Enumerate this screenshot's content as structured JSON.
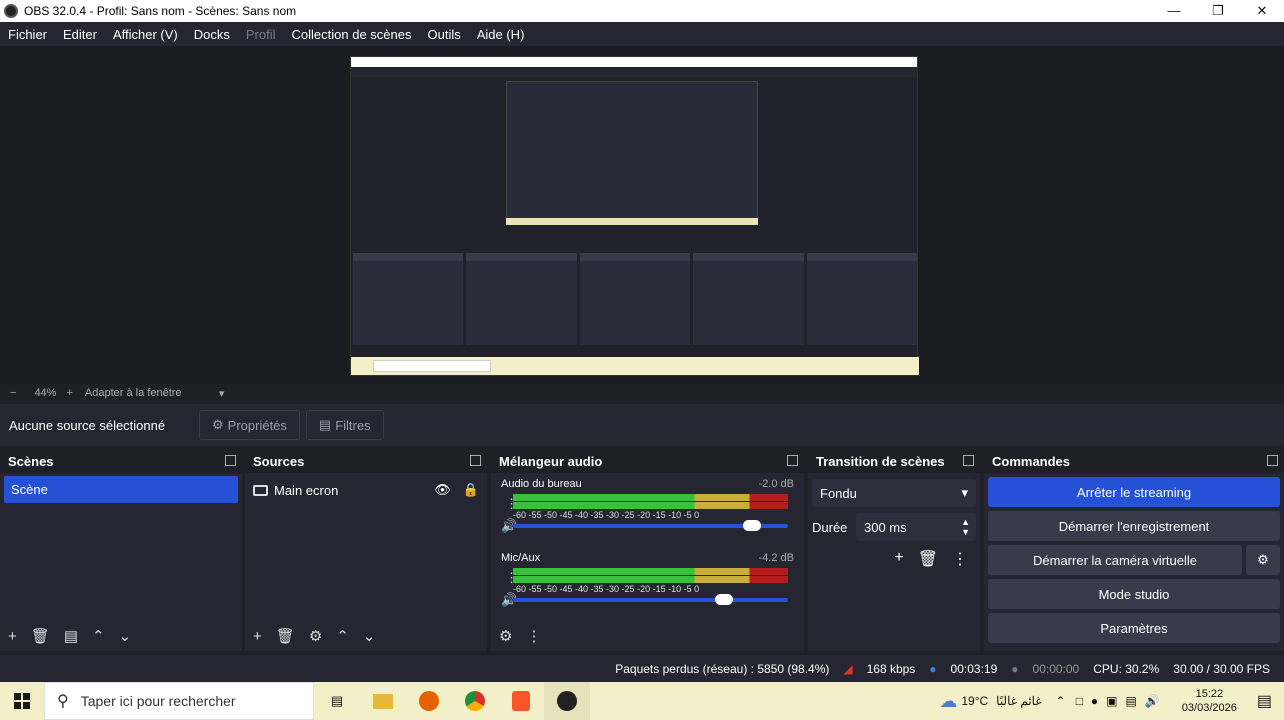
{
  "window": {
    "title": "OBS 32.0.4 - Profil: Sans nom - Scènes: Sans nom"
  },
  "menu": [
    "Fichier",
    "Editer",
    "Afficher (V)",
    "Docks",
    "Profil",
    "Collection de scènes",
    "Outils",
    "Aide (H)"
  ],
  "zoom": {
    "value": "44%",
    "fit": "Adapter à la fenêtre"
  },
  "source_bar": {
    "status": "Aucune source sélectionné",
    "properties": "Propriétés",
    "filters": "Filtres"
  },
  "scenes": {
    "title": "Scènes",
    "items": [
      "Scène"
    ]
  },
  "sources": {
    "title": "Sources",
    "items": [
      "Main ecron"
    ]
  },
  "mixer": {
    "title": "Mélangeur audio",
    "channels": [
      {
        "name": "Audio du bureau",
        "db": "-2.0 dB",
        "level": 0.9
      },
      {
        "name": "Mic/Aux",
        "db": "-4.2 dB",
        "level": 0.8
      }
    ],
    "ticks": "-60 -55 -50 -45 -40 -35 -30 -25 -20 -15 -10 -5 0"
  },
  "transition": {
    "title": "Transition de scènes",
    "type": "Fondu",
    "duration_label": "Durée",
    "duration": "300 ms"
  },
  "commands": {
    "title": "Commandes",
    "stop_stream": "Arrêter le streaming",
    "start_rec": "Démarrer l'enregistrement",
    "virtual_cam": "Démarrer la caméra virtuelle",
    "studio": "Mode studio",
    "settings": "Paramètres"
  },
  "status": {
    "dropped": "Paquets perdus (réseau) : 5850 (98.4%)",
    "bitrate": "168 kbps",
    "stream_time": "00:03:19",
    "rec_time": "00:00:00",
    "cpu": "CPU: 30.2%",
    "fps": "30.00 / 30.00 FPS"
  },
  "taskbar": {
    "search": "Taper ici pour rechercher",
    "temp": "19°C",
    "weather": "غائم غالبًا",
    "time": "15:22",
    "date": "03/03/2026"
  }
}
